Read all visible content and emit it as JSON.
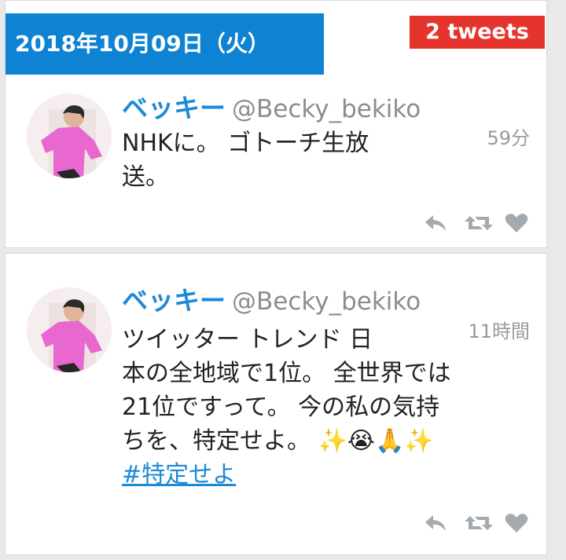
{
  "header": {
    "date": "2018年10月09日（火）",
    "tweet_count": "2 tweets"
  },
  "colors": {
    "date_banner": "#0f83d3",
    "count_badge": "#e5332d",
    "display_name": "#1c8ad6",
    "hashtag": "#1c8ad6"
  },
  "tweets": [
    {
      "display_name": "ベッキー",
      "handle": "@Becky_bekiko",
      "time": "59分",
      "text_lines": [
        "NHKに。 ゴトーチ生放",
        "送。"
      ],
      "actions": [
        "reply-icon",
        "retweet-icon",
        "like-icon"
      ]
    },
    {
      "display_name": "ベッキー",
      "handle": "@Becky_bekiko",
      "time": "11時間",
      "text_lines": [
        "ツイッター トレンド 日",
        "本の全地域で1位。 全世界では",
        "21位ですって。 今の私の気持",
        "ちを、特定せよ。 ✨😭🙏✨"
      ],
      "hashtag": "#特定せよ",
      "actions": [
        "reply-icon",
        "retweet-icon",
        "like-icon"
      ]
    }
  ]
}
